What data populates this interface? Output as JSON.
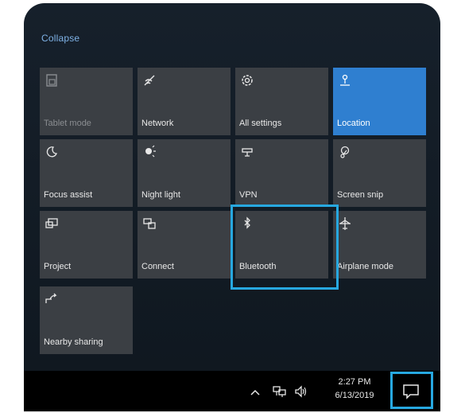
{
  "action_center": {
    "collapse_label": "Collapse",
    "tiles": [
      {
        "label": "Tablet mode",
        "icon": "tablet-mode-icon",
        "state": "disabled"
      },
      {
        "label": "Network",
        "icon": "network-icon",
        "state": "normal"
      },
      {
        "label": "All settings",
        "icon": "settings-gear-icon",
        "state": "normal"
      },
      {
        "label": "Location",
        "icon": "location-icon",
        "state": "active"
      },
      {
        "label": "Focus assist",
        "icon": "focus-assist-moon-icon",
        "state": "normal"
      },
      {
        "label": "Night light",
        "icon": "night-light-icon",
        "state": "normal"
      },
      {
        "label": "VPN",
        "icon": "vpn-icon",
        "state": "normal"
      },
      {
        "label": "Screen snip",
        "icon": "screen-snip-icon",
        "state": "normal"
      },
      {
        "label": "Project",
        "icon": "project-icon",
        "state": "normal"
      },
      {
        "label": "Connect",
        "icon": "connect-icon",
        "state": "normal"
      },
      {
        "label": "Bluetooth",
        "icon": "bluetooth-icon",
        "state": "normal"
      },
      {
        "label": "Airplane mode",
        "icon": "airplane-icon",
        "state": "normal"
      },
      {
        "label": "Nearby sharing",
        "icon": "nearby-sharing-icon",
        "state": "normal"
      }
    ]
  },
  "taskbar": {
    "time": "2:27 PM",
    "date": "6/13/2019",
    "tray_icons": [
      "chevron-up-icon",
      "network-monitor-icon",
      "speaker-icon",
      "action-center-icon"
    ]
  },
  "colors": {
    "tile_bg": "#3b3f44",
    "tile_active_bg": "#2f7fd0",
    "highlight": "#27a8e0",
    "collapse_link": "#7fb2e6"
  }
}
